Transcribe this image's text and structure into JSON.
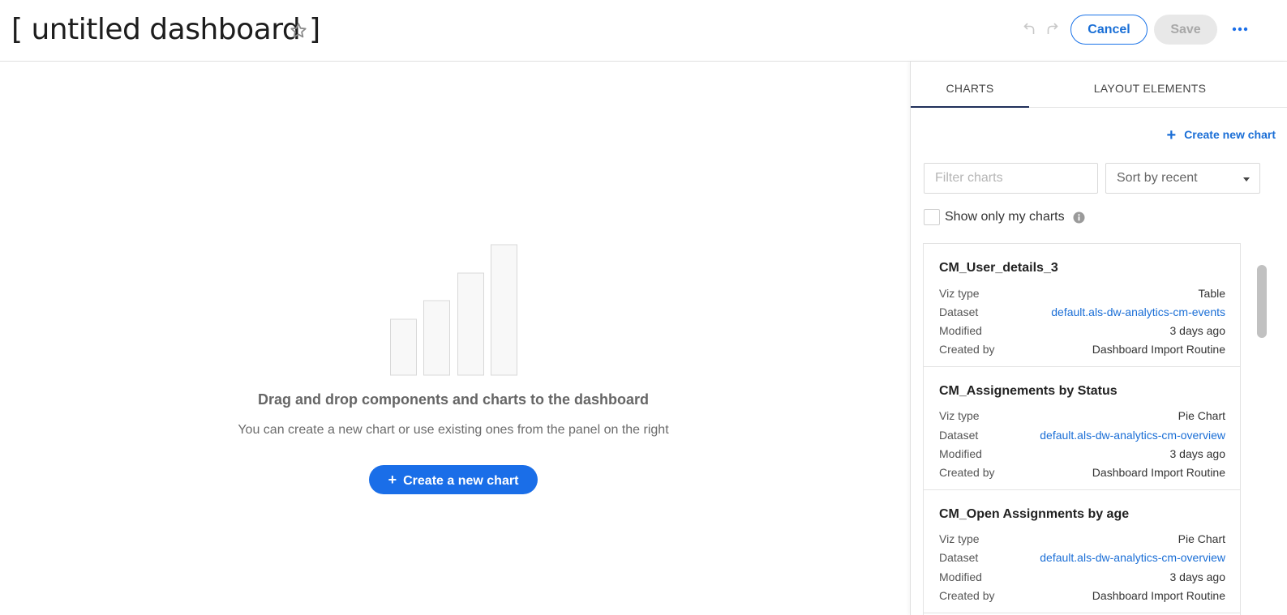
{
  "header": {
    "title": "[ untitled dashboard ]",
    "cancel_label": "Cancel",
    "save_label": "Save"
  },
  "empty_state": {
    "title": "Drag and drop components and charts to the dashboard",
    "subtitle": "You can create a new chart or use existing ones from the panel on the right",
    "create_button_label": "Create a new chart",
    "create_button_icon": "+"
  },
  "panel": {
    "tabs": [
      {
        "label": "CHARTS",
        "active": true
      },
      {
        "label": "LAYOUT ELEMENTS",
        "active": false
      }
    ],
    "create_link_icon": "+",
    "create_link_label": "Create new chart",
    "filter_placeholder": "Filter charts",
    "filter_value": "",
    "sort_selected": "Sort by recent",
    "show_only_mine_label": "Show only my charts",
    "show_only_mine_checked": false,
    "field_labels": {
      "viz_type": "Viz type",
      "dataset": "Dataset",
      "modified": "Modified",
      "created_by": "Created by"
    },
    "charts": [
      {
        "name": "CM_User_details_3",
        "viz_type": "Table",
        "dataset": "default.als-dw-analytics-cm-events",
        "modified": "3 days ago",
        "created_by": "Dashboard Import Routine"
      },
      {
        "name": "CM_Assignements by Status",
        "viz_type": "Pie Chart",
        "dataset": "default.als-dw-analytics-cm-overview",
        "modified": "3 days ago",
        "created_by": "Dashboard Import Routine"
      },
      {
        "name": "CM_Open Assignments by age",
        "viz_type": "Pie Chart",
        "dataset": "default.als-dw-analytics-cm-overview",
        "modified": "3 days ago",
        "created_by": "Dashboard Import Routine"
      }
    ]
  },
  "colors": {
    "accent": "#1a6ee8",
    "link": "#1a6ed6",
    "tab_active_underline": "#20305a",
    "save_disabled_bg": "#e8e8e8"
  },
  "icons": {
    "star": "star-icon",
    "undo": "undo-icon",
    "redo": "redo-icon",
    "more": "more-icon",
    "info": "info-icon",
    "caret": "caret-down-icon",
    "empty_chart": "empty-chart-icon"
  }
}
